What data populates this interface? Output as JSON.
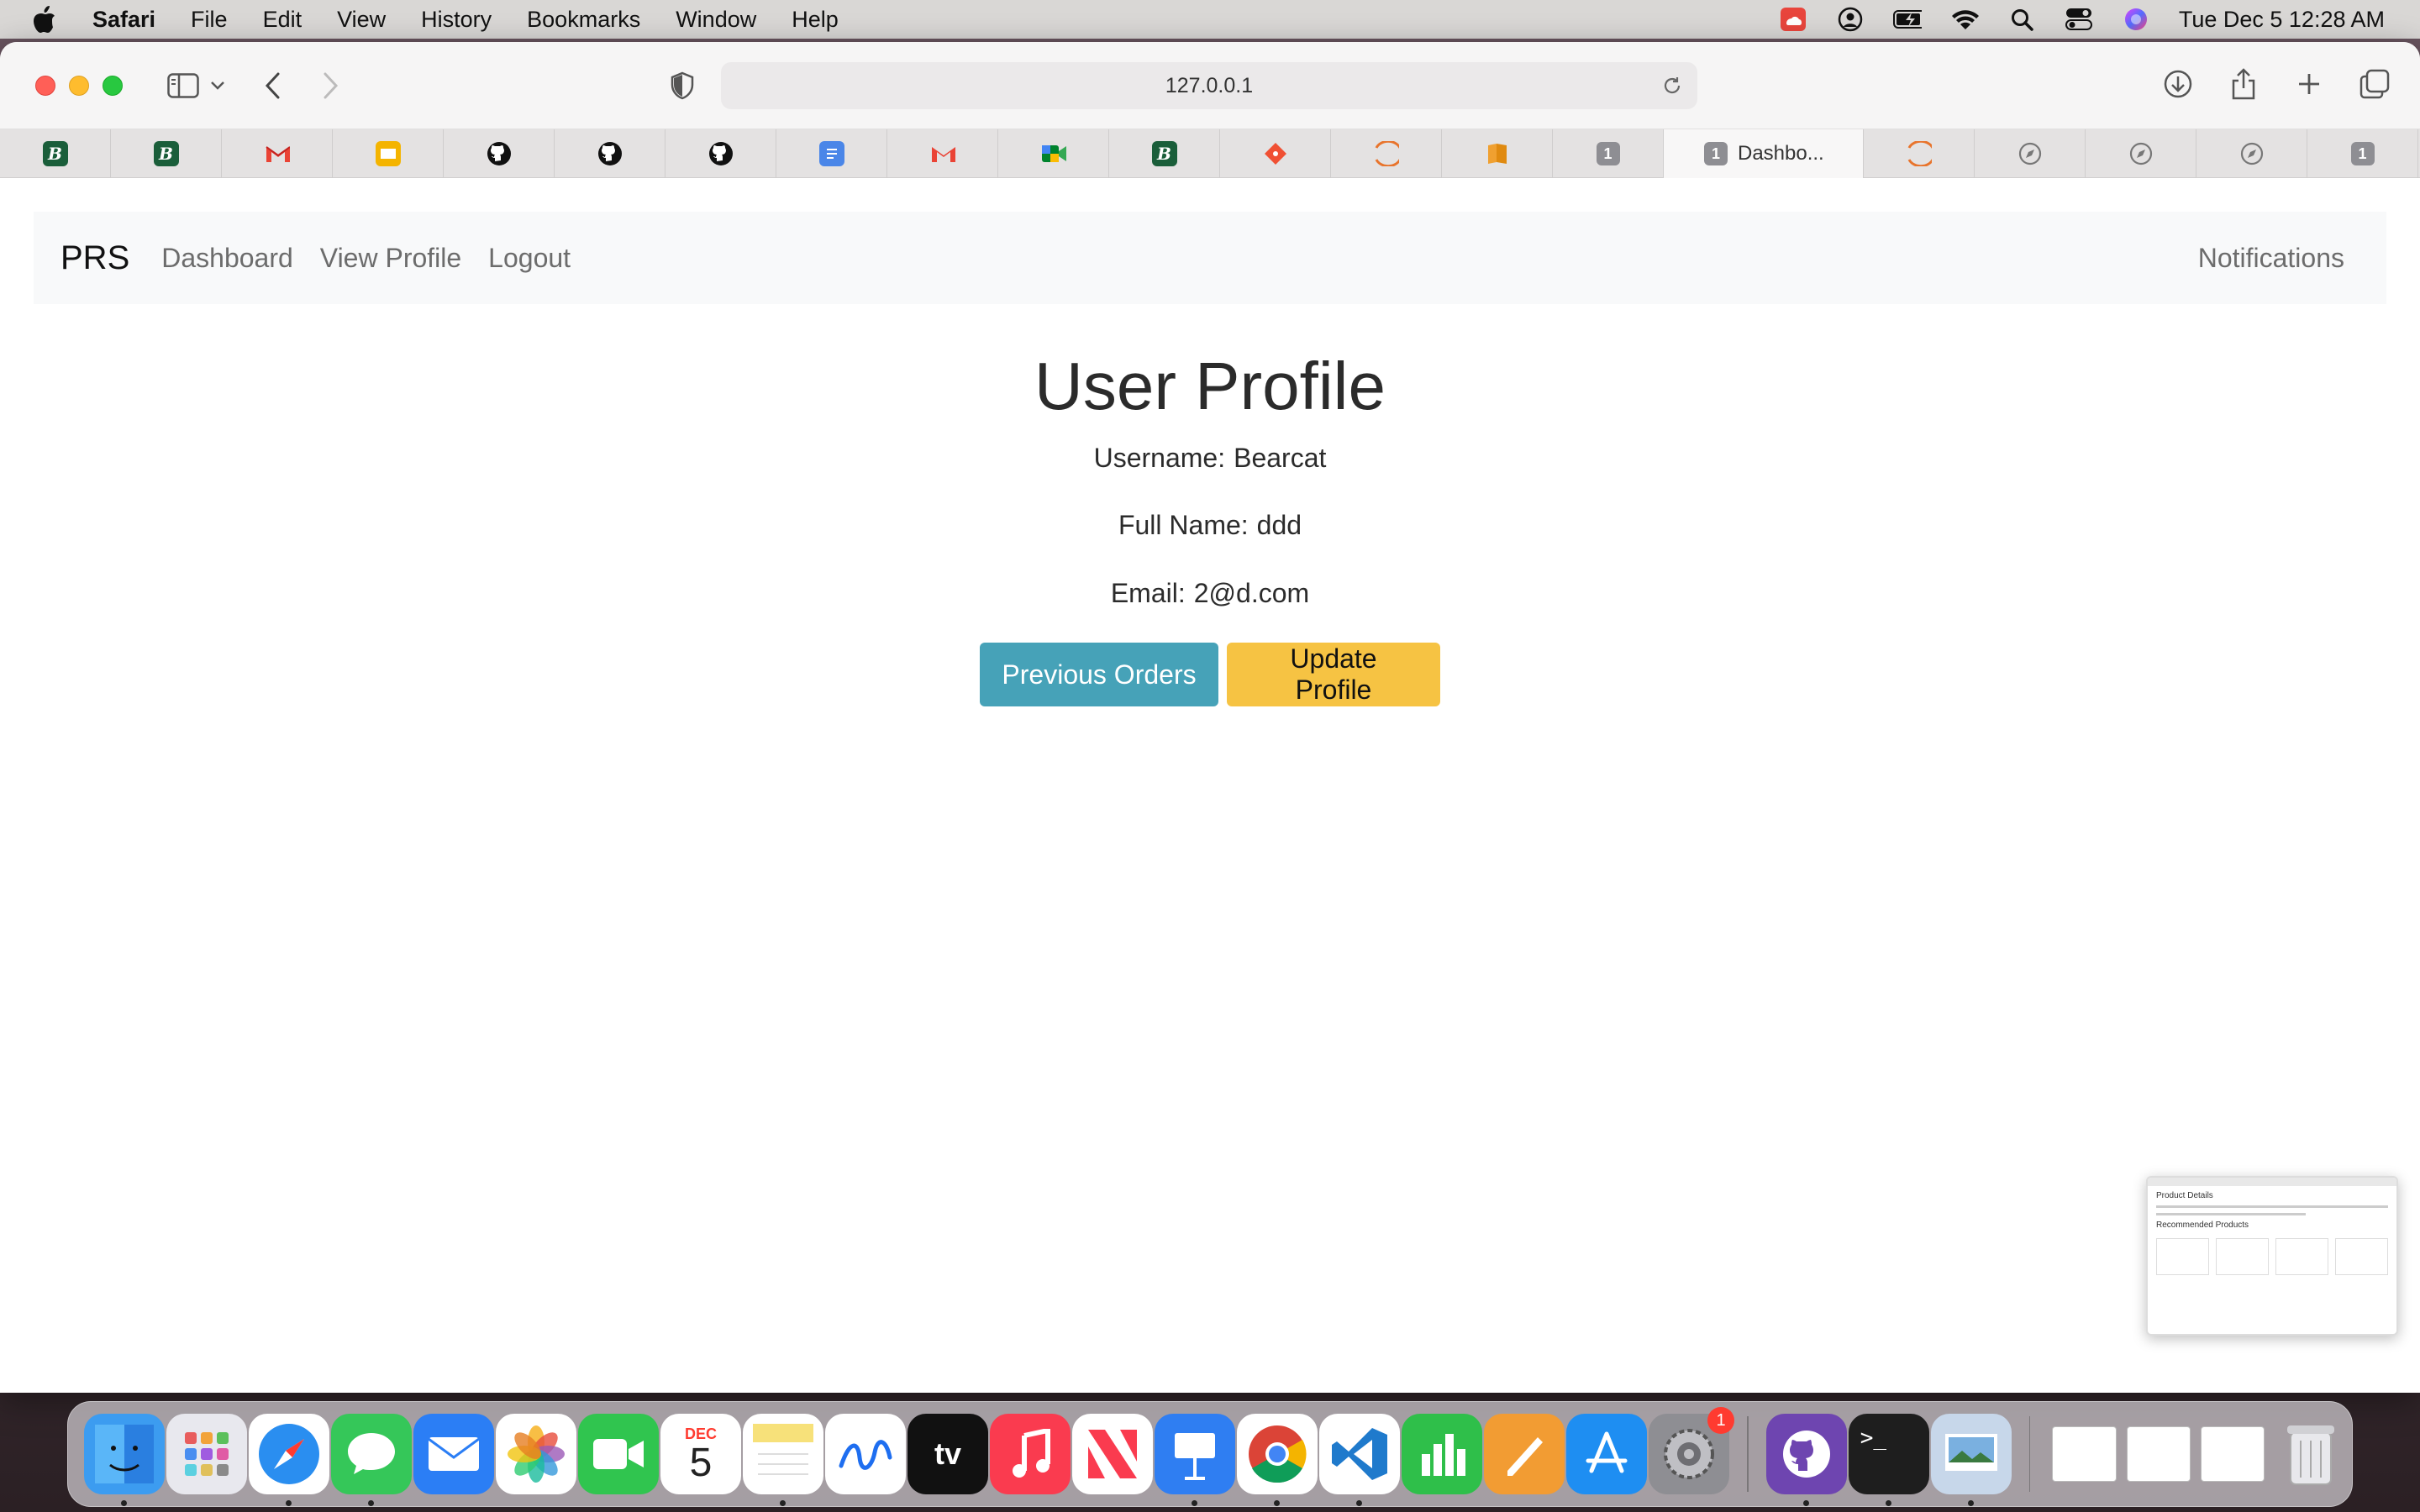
{
  "menubar": {
    "app_name": "Safari",
    "menus": [
      "File",
      "Edit",
      "View",
      "History",
      "Bookmarks",
      "Window",
      "Help"
    ],
    "clock": "Tue Dec 5  12:28 AM",
    "status_icons": [
      "creative-cloud-icon",
      "user-circle-icon",
      "battery-charging-icon",
      "wifi-icon",
      "spotlight-search-icon",
      "control-center-icon",
      "siri-icon"
    ]
  },
  "browser": {
    "address": "127.0.0.1",
    "tabs": [
      {
        "icon": "b-logo-icon",
        "label": "B"
      },
      {
        "icon": "b-logo-icon",
        "label": "B"
      },
      {
        "icon": "gmail-icon",
        "label": "M"
      },
      {
        "icon": "slides-icon",
        "label": ""
      },
      {
        "icon": "github-icon",
        "label": ""
      },
      {
        "icon": "github-icon",
        "label": ""
      },
      {
        "icon": "github-icon",
        "label": ""
      },
      {
        "icon": "docs-icon",
        "label": ""
      },
      {
        "icon": "gmail-icon",
        "label": "M"
      },
      {
        "icon": "meet-icon",
        "label": ""
      },
      {
        "icon": "b-logo-icon",
        "label": "B"
      },
      {
        "icon": "git-diamond-icon",
        "label": ""
      },
      {
        "icon": "loader-icon",
        "label": ""
      },
      {
        "icon": "book-icon",
        "label": ""
      },
      {
        "icon": "number-icon",
        "label": "1"
      }
    ],
    "active_tab": {
      "badge": "1",
      "label": "Dashbo..."
    },
    "trailing_tabs": [
      {
        "icon": "loader-icon",
        "label": ""
      },
      {
        "icon": "compass-icon",
        "label": ""
      },
      {
        "icon": "compass-icon",
        "label": ""
      },
      {
        "icon": "compass-icon",
        "label": ""
      },
      {
        "icon": "number-icon",
        "label": "1"
      }
    ]
  },
  "navbar": {
    "brand": "PRS",
    "links": [
      "Dashboard",
      "View Profile",
      "Logout"
    ],
    "right_link": "Notifications"
  },
  "profile": {
    "title": "User Profile",
    "username_label": "Username:",
    "username": "Bearcat",
    "fullname_label": "Full Name:",
    "fullname": "ddd",
    "email_label": "Email:",
    "email": "2@d.com",
    "btn_orders": "Previous Orders",
    "btn_update": "Update Profile"
  },
  "thumbnail": {
    "title": "Product Details",
    "subtitle": "Recommended Products"
  },
  "dock": {
    "calendar_month": "DEC",
    "calendar_day": "5",
    "appletv_label": "tv",
    "settings_badge": "1",
    "terminal_label": ">_",
    "colors": {
      "finder": "#3c9cf0",
      "launchpad": "#e8e8ee",
      "safari": "#2a8ef0",
      "messages": "#35c759",
      "mail": "#2b7ef5",
      "photos": "#ffffff",
      "facetime": "#30c54f",
      "calendar": "#ffffff",
      "notes": "#f7e17a",
      "freeform": "#ffffff",
      "appletv": "#111111",
      "music": "#fa3b4f",
      "news": "#ffffff",
      "keynote": "#2f7ef2",
      "chrome": "#ffffff",
      "vscode": "#1f7acc",
      "numbers": "#2fbf4a",
      "pages": "#f29c33",
      "appstore": "#1e8ef2",
      "settings": "#8e8e93",
      "github": "#6e45b0",
      "terminal": "#1e1e1e",
      "preview": "#c7d7ea",
      "trash": "#d8d8dc"
    }
  }
}
